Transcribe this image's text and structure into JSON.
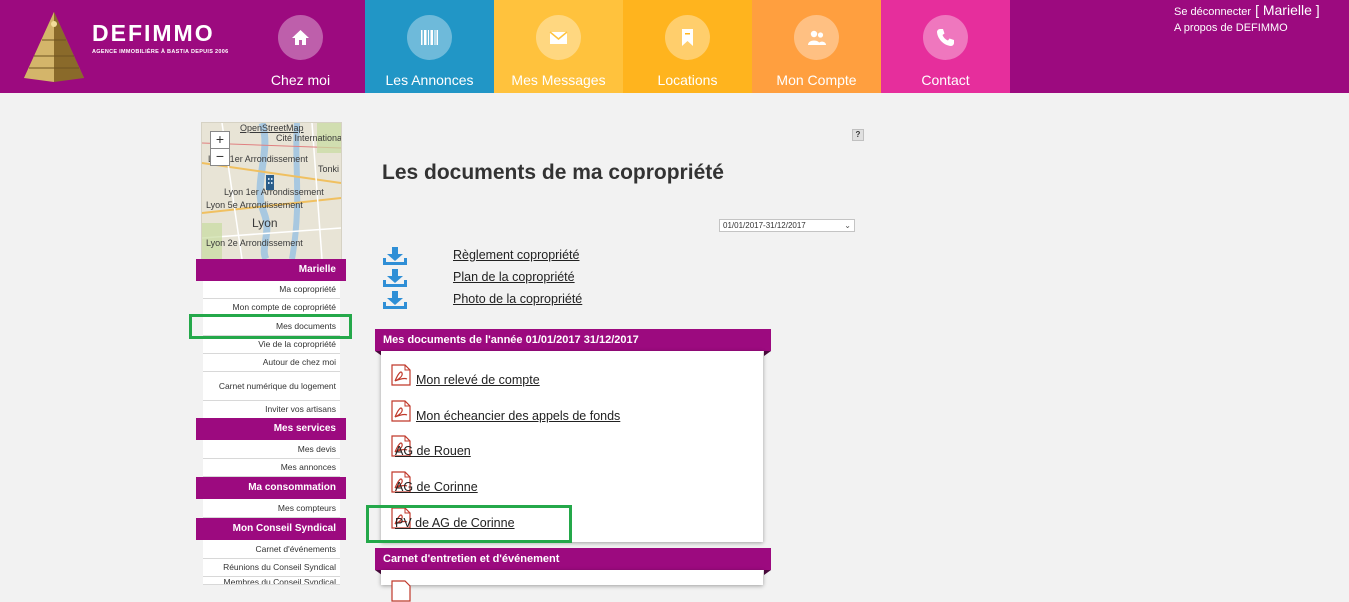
{
  "colors": {
    "brand_purple": "#9c0a7f",
    "nav_chez_moi": "#9c0a7f",
    "nav_annonces": "#2196c6",
    "nav_messages": "#ffc23d",
    "nav_locations": "#ffb41e",
    "nav_compte": "#ff9f3f",
    "nav_contact": "#e62e9c",
    "highlight_green": "#24a84a",
    "pdf_red": "#c0392b"
  },
  "header": {
    "brand": "DEFIMMO",
    "tagline": "AGENCE IMMOBILIÈRE À BASTIA DEPUIS 2006",
    "nav": [
      {
        "label": "Chez moi",
        "icon": "home-icon"
      },
      {
        "label": "Les Annonces",
        "icon": "barcode-icon"
      },
      {
        "label": "Mes Messages",
        "icon": "envelope-icon"
      },
      {
        "label": "Locations",
        "icon": "bookmark-icon"
      },
      {
        "label": "Mon Compte",
        "icon": "users-icon"
      },
      {
        "label": "Contact",
        "icon": "phone-icon"
      }
    ],
    "logout_label": "Se déconnecter",
    "user_name": "[ Marielle ]",
    "about_label": "A propos de DEFIMMO"
  },
  "map": {
    "attribution": "OpenStreetMap",
    "labels": [
      "Cité Internationa",
      "Lyon 1er Arrondissement",
      "Tonki",
      "Lyon 1er Arrondissement",
      "Lyon 5e Arrondissement",
      "Lyon",
      "Lyon 2e Arrondissement"
    ],
    "zoom_in": "+",
    "zoom_out": "−"
  },
  "sidebar": {
    "sections": [
      {
        "title": "Marielle",
        "items": [
          "Ma copropriété",
          "Mon compte de copropriété",
          "Mes documents",
          "Vie de la copropriété",
          "Autour de chez moi",
          "Carnet numérique du logement",
          "Inviter vos artisans"
        ]
      },
      {
        "title": "Mes services",
        "items": [
          "Mes devis",
          "Mes annonces"
        ]
      },
      {
        "title": "Ma consommation",
        "items": [
          "Mes compteurs"
        ]
      },
      {
        "title": "Mon Conseil Syndical",
        "items": [
          "Carnet d'événements",
          "Réunions du Conseil Syndical",
          "Membres du Conseil Syndical"
        ]
      }
    ]
  },
  "main": {
    "help": "?",
    "title": "Les documents de ma copropriété",
    "period_selected": "01/01/2017-31/12/2017",
    "downloads": [
      "Règlement copropriété",
      "Plan de la copropriété",
      "Photo de la copropriété"
    ],
    "panel_title": "Mes documents de l'année 01/01/2017 31/12/2017",
    "documents": [
      "Mon relevé de compte",
      "Mon écheancier des appels de fonds",
      "AG de Rouen",
      "AG de Corinne",
      "PV de AG de Corinne"
    ],
    "panel2_title": "Carnet d'entretien et d'événement"
  }
}
